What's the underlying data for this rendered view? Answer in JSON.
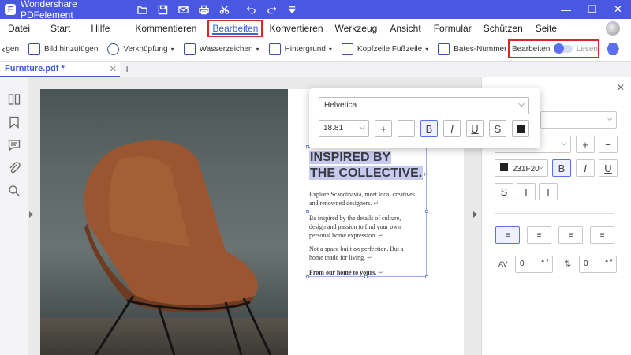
{
  "app": {
    "title": "Wondershare PDFelement",
    "logo": "F"
  },
  "quick_icons": [
    "folder-icon",
    "save-icon",
    "mail-icon",
    "print-icon",
    "scissors-icon",
    "undo-icon",
    "redo-icon",
    "customize-icon"
  ],
  "window_controls": {
    "min": "—",
    "max": "☐",
    "close": "✕"
  },
  "menu": [
    "Datei",
    "Start",
    "Hilfe",
    "Kommentieren",
    "Bearbeiten",
    "Konvertieren",
    "Werkzeug",
    "Ansicht",
    "Formular",
    "Schützen",
    "Seite"
  ],
  "menu_active": "Bearbeiten",
  "toolbar": {
    "scroll_left": "‹",
    "items": [
      "gen",
      "Bild hinzufügen",
      "Verknüpfung",
      "Wasserzeichen",
      "Hintergrund",
      "Kopfzeile",
      "Fußzeile",
      "Bates-Nummer"
    ],
    "dropdown": "▾",
    "mode_edit": "Bearbeiten",
    "mode_read": "Lesen"
  },
  "tab": {
    "name": "Furniture.pdf *",
    "close": "✕",
    "new": "+"
  },
  "document": {
    "headline": [
      "INSPIRED BY",
      "THE COLLECTIVE."
    ],
    "return_mark": "↵",
    "paragraphs": [
      [
        "Explore Scandinavia, meet local creatives",
        "and renowned designers."
      ],
      [
        "Be inspired by the details of culture,",
        "design and passion to find your own",
        "personal home expression."
      ],
      [
        "Not a space built on perfection. But a",
        "home made for living."
      ],
      [
        "From our home to yours."
      ]
    ]
  },
  "popup": {
    "font": "Helvetica",
    "size": "18.81",
    "plus": "+",
    "minus": "−",
    "bold": "B",
    "italic": "I",
    "underline": "U",
    "strike": "S",
    "chevron": "⌵"
  },
  "right_panel": {
    "close": "✕",
    "color_value": "231F20",
    "plus": "+",
    "minus": "−",
    "bold": "B",
    "italic": "I",
    "underline": "U",
    "strike": "S",
    "superscript": "T",
    "subscript": "T",
    "char_spacing_value": "0",
    "line_spacing_value": "0",
    "chevron": "⌵",
    "spinner": "▲▼"
  },
  "colors": {
    "accent": "#4a57e0",
    "highlight": "#c6cbee",
    "text_color": "#231F20",
    "annotation_red": "#d9262a"
  }
}
